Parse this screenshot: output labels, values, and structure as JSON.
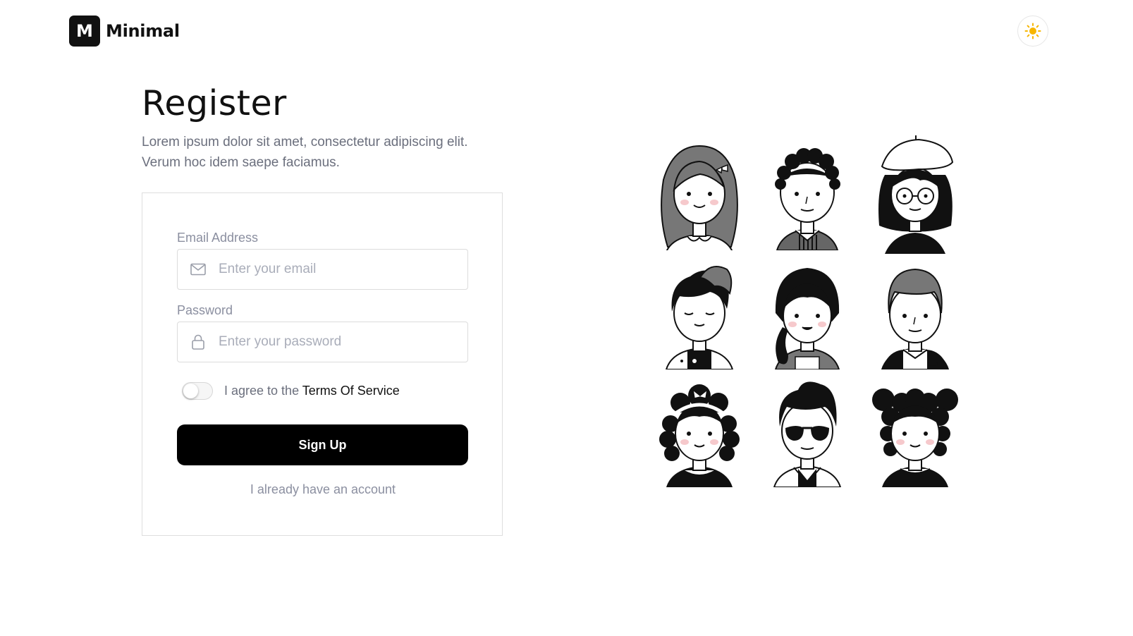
{
  "brand": {
    "name": "Minimal",
    "mark": "M"
  },
  "theme_toggle": {
    "icon": "sun-icon",
    "color": "#f7b500"
  },
  "page": {
    "title": "Register",
    "subtitle_line1": "Lorem ipsum dolor sit amet, consectetur adipiscing elit.",
    "subtitle_line2": "Verum hoc idem saepe faciamus."
  },
  "form": {
    "email": {
      "label": "Email Address",
      "placeholder": "Enter your email",
      "value": "",
      "icon": "mail-icon"
    },
    "password": {
      "label": "Password",
      "placeholder": "Enter your password",
      "value": "",
      "icon": "lock-icon"
    },
    "agree": {
      "prefix": "I agree to the",
      "link": "Terms Of Service",
      "checked": false
    },
    "submit_label": "Sign Up",
    "login_link": "I already have an account"
  },
  "illustration": {
    "avatars": [
      "girl-bow",
      "curly-boy",
      "beret-glasses-woman",
      "winking-boy",
      "ponytail-girl",
      "grey-hair-man",
      "headband-girl",
      "sunglasses-boy",
      "puff-hair-girl"
    ],
    "cheek_color": "#f6c9cc"
  }
}
